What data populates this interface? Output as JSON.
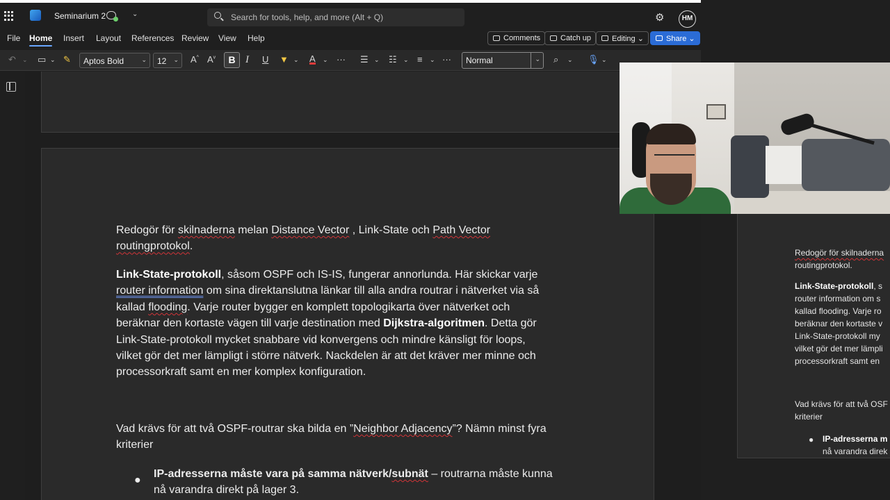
{
  "titlebar": {
    "doc_title": "Seminarium 2",
    "search_placeholder": "Search for tools, help, and more (Alt + Q)",
    "avatar_initials": "HM"
  },
  "menu": {
    "items": [
      "File",
      "Home",
      "Insert",
      "Layout",
      "References",
      "Review",
      "View",
      "Help"
    ],
    "active": "Home",
    "comments_label": "Comments",
    "catchup_label": "Catch up",
    "editing_label": "Editing",
    "share_label": "Share"
  },
  "ribbon": {
    "font_name": "Aptos Bold",
    "font_size": "12",
    "style_name": "Normal"
  },
  "document": {
    "q1_line1_a": "Redogör för ",
    "q1_line1_b": "skilnaderna",
    "q1_line1_c": " melan ",
    "q1_line1_d": "Distance Vector",
    "q1_line1_e": " , Link-State och ",
    "q1_line1_f": "Path Vector",
    "q1_line2": "routingprotokol",
    "q1_line2_end": ".",
    "p1_bold": "Link-State-protokoll",
    "p1_line1": ", såsom OSPF och IS-IS, fungerar annorlunda. Här skickar varje",
    "p1_line2_a": "router information",
    "p1_line2_b": " om sina direktanslutna länkar till alla andra routrar i nätverket via så",
    "p1_line3_a": "kallad ",
    "p1_line3_b": "flooding",
    "p1_line3_c": ". Varje router bygger en komplett topologikarta över nätverket och",
    "p1_line4_a": "beräknar den kortaste vägen till varje destination med ",
    "p1_line4_b": "Dijkstra-algoritmen",
    "p1_line4_c": ". Detta gör",
    "p1_line5": "Link-State-protokoll mycket snabbare vid konvergens och mindre känsligt för loops,",
    "p1_line6": "vilket gör det mer lämpligt i större nätverk. Nackdelen är att det kräver mer minne och",
    "p1_line7": "processorkraft samt en mer komplex konfiguration.",
    "q2_line1_a": "Vad krävs för att två OSPF-routrar ska bilda en ”",
    "q2_line1_b": "Neighbor Adjacency",
    "q2_line1_c": "”? Nämn minst fyra",
    "q2_line2": "kriterier",
    "bullet1_bold": "IP-adresserna måste vara på samma nätverk/",
    "bullet1_bold_sq": "subnät",
    "bullet1_rest": " – routrarna måste kunna",
    "bullet1_line2": "nå varandra direkt på lager 3."
  },
  "preview": {
    "q1_line1": "Redogör för skilnaderna",
    "q1_line2": "routingprotokol.",
    "p1_bold": "Link-State-protokoll",
    "p1_line1_rest": ", s",
    "p1_line2": "router information om s",
    "p1_line3": "kallad flooding. Varje ro",
    "p1_line4": "beräknar den kortaste v",
    "p1_line5": "Link-State-protokoll my",
    "p1_line6": "vilket gör det mer lämpli",
    "p1_line7": "processorkraft samt en",
    "q2_line1": "Vad krävs för att två OSF",
    "q2_line2": "kriterier",
    "bullet_bold": "IP-adresserna m",
    "bullet_line2": "nå varandra direk"
  },
  "icons": {
    "apps": "waffle-icon",
    "word": "word-logo-icon",
    "saved": "cloud-saved-icon",
    "search": "search-icon",
    "settings": "gear-icon"
  },
  "colors": {
    "accent": "#2b6cd6",
    "spell_error": "#d13438",
    "grammar": "#6a8ee6"
  }
}
